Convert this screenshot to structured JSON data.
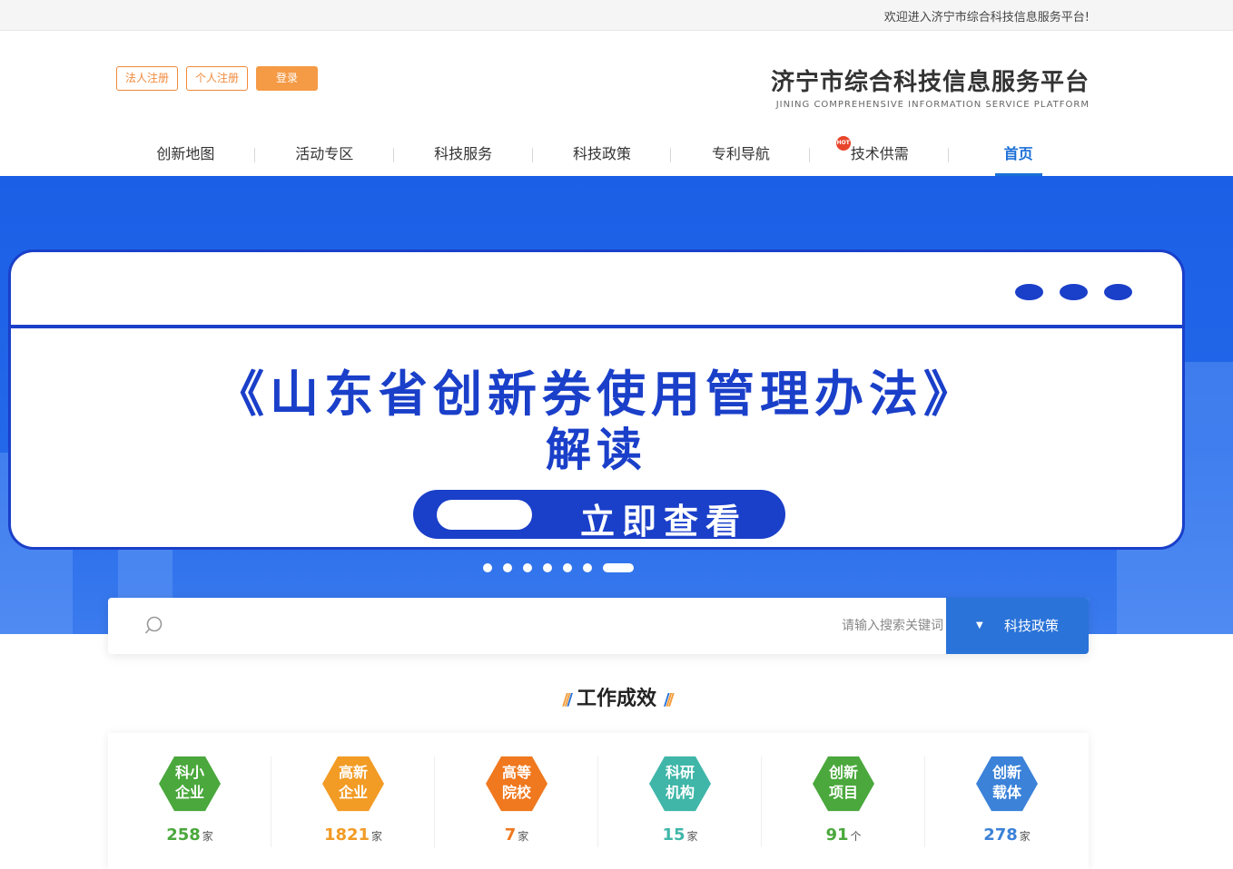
{
  "topbar": {
    "welcome": "欢迎进入济宁市综合科技信息服务平台!"
  },
  "header": {
    "logo_cn": "济宁市综合科技信息服务平台",
    "logo_en": "JINING COMPREHENSIVE INFORMATION SERVICE PLATFORM",
    "login": "登录",
    "register_personal": "个人注册",
    "register_corp": "法人注册"
  },
  "nav": {
    "items": [
      "首页",
      "技术供需",
      "专利导航",
      "科技政策",
      "科技服务",
      "活动专区",
      "创新地图"
    ],
    "active": "首页",
    "hot_badge": "HOT"
  },
  "banner": {
    "title": "《山东省创新券使用管理办法》",
    "subtitle": "解读",
    "cta": "立即查看",
    "slide_count": 7,
    "active_slide": 7
  },
  "search": {
    "category": "科技政策",
    "placeholder": "请输入搜索关键词",
    "value": ""
  },
  "section": {
    "title": "工作成效"
  },
  "stats": [
    {
      "line1": "创新",
      "line2": "载体",
      "value": "278",
      "unit": "家",
      "color": "#3b82d8"
    },
    {
      "line1": "创新",
      "line2": "项目",
      "value": "91",
      "unit": "个",
      "color": "#4aa83c"
    },
    {
      "line1": "科研",
      "line2": "机构",
      "value": "15",
      "unit": "家",
      "color": "#3fb6a8"
    },
    {
      "line1": "高等",
      "line2": "院校",
      "value": "7",
      "unit": "家",
      "color": "#f0781e"
    },
    {
      "line1": "高新",
      "line2": "企业",
      "value": "1821",
      "unit": "家",
      "color": "#f29b25"
    },
    {
      "line1": "科小",
      "line2": "企业",
      "value": "258",
      "unit": "家",
      "color": "#4aa83c"
    }
  ],
  "colors": {
    "primary": "#2a73d8",
    "accent": "#f59a45",
    "banner_bg": "#1b5fe6"
  }
}
